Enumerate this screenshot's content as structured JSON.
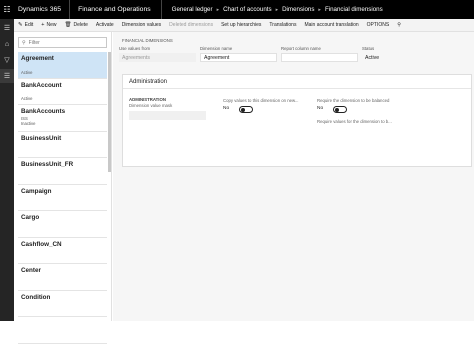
{
  "topbar": {
    "menu_icon": "waffle-icon",
    "product": "Dynamics 365",
    "app": "Finance and Operations",
    "breadcrumbs": [
      "General ledger",
      "Chart of accounts",
      "Dimensions",
      "Financial dimensions"
    ]
  },
  "nav": {
    "icons": [
      "hamburger-icon",
      "home-icon",
      "filter-icon",
      "modules-icon"
    ]
  },
  "actions": {
    "edit": "Edit",
    "new": "New",
    "delete": "Delete",
    "activate": "Activate",
    "dimension_values": "Dimension values",
    "deleted_dimensions": "Deleted dimensions",
    "setup_hierarchies": "Set up hierarchies",
    "translations": "Translations",
    "main_account_translation": "Main account translation",
    "options": "OPTIONS"
  },
  "list": {
    "filter_placeholder": "Filter",
    "items": [
      {
        "name": "Agreement",
        "line2": "",
        "line3": "",
        "status": "Active",
        "selected": true
      },
      {
        "name": "BankAccount",
        "line2": "",
        "line3": "",
        "status": "Active",
        "selected": false
      },
      {
        "name": "BankAccounts",
        "line2": "ISS",
        "line3": "Inactive",
        "status": "",
        "selected": false
      },
      {
        "name": "BusinessUnit",
        "line2": "",
        "line3": "",
        "status": "",
        "selected": false
      },
      {
        "name": "BusinessUnit_FR",
        "line2": "",
        "line3": "",
        "status": "",
        "selected": false
      },
      {
        "name": "Campaign",
        "line2": "",
        "line3": "",
        "status": "",
        "selected": false
      },
      {
        "name": "Cargo",
        "line2": "",
        "line3": "",
        "status": "",
        "selected": false
      },
      {
        "name": "Cashflow_CN",
        "line2": "",
        "line3": "",
        "status": "",
        "selected": false
      },
      {
        "name": "Center",
        "line2": "",
        "line3": "",
        "status": "",
        "selected": false
      },
      {
        "name": "Condition",
        "line2": "",
        "line3": "",
        "status": "",
        "selected": false
      },
      {
        "name": "",
        "line2": "",
        "line3": "",
        "status": "",
        "selected": false
      }
    ]
  },
  "details": {
    "caption": "FINANCIAL DIMENSIONS",
    "use_values_from_label": "Use values from",
    "use_values_from_value": "Agreements",
    "dimension_name_label": "Dimension name",
    "dimension_name_value": "Agreement",
    "report_column_name_label": "Report column name",
    "report_column_name_value": "",
    "status_label": "Status",
    "status_value": "Active",
    "fasttab_title": "Administration",
    "group_title": "ADMINISTRATION",
    "value_mask_label": "Dimension value mask",
    "copy_values_label": "Copy values to this dimension on new...",
    "copy_values_value": "No",
    "require_balanced_label": "Require the dimension to be balanced",
    "require_balanced_value": "No",
    "require_values_label": "Require values for the dimension to b..."
  }
}
